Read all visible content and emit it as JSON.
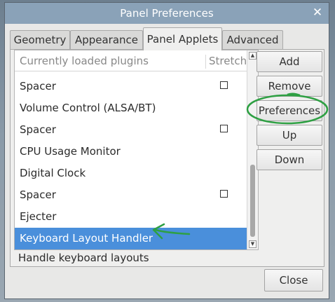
{
  "window": {
    "title": "Panel Preferences",
    "close_glyph": "✕"
  },
  "tabs": [
    {
      "label": "Geometry",
      "active": false
    },
    {
      "label": "Appearance",
      "active": false
    },
    {
      "label": "Panel Applets",
      "active": true
    },
    {
      "label": "Advanced",
      "active": false
    }
  ],
  "plugin_list": {
    "column_plugins": "Currently loaded plugins",
    "column_stretch": "Stretch",
    "rows": [
      {
        "label": "Spacer",
        "stretch_checkbox": true,
        "stretch_checked": false,
        "selected": false
      },
      {
        "label": "Volume Control (ALSA/BT)",
        "stretch_checkbox": false,
        "selected": false
      },
      {
        "label": "Spacer",
        "stretch_checkbox": true,
        "stretch_checked": false,
        "selected": false
      },
      {
        "label": "CPU Usage Monitor",
        "stretch_checkbox": false,
        "selected": false
      },
      {
        "label": "Digital Clock",
        "stretch_checkbox": false,
        "selected": false
      },
      {
        "label": "Spacer",
        "stretch_checkbox": true,
        "stretch_checked": false,
        "selected": false
      },
      {
        "label": "Ejecter",
        "stretch_checkbox": false,
        "selected": false
      },
      {
        "label": "Keyboard Layout Handler",
        "stretch_checkbox": false,
        "selected": true
      }
    ],
    "description": "Handle keyboard layouts"
  },
  "side_buttons": {
    "add": "Add",
    "remove": "Remove",
    "preferences": "Preferences",
    "up": "Up",
    "down": "Down"
  },
  "footer": {
    "close": "Close"
  },
  "colors": {
    "selection": "#4a8fdb",
    "annotation_green": "#2ea043",
    "titlebar": "#8aa2b8"
  }
}
